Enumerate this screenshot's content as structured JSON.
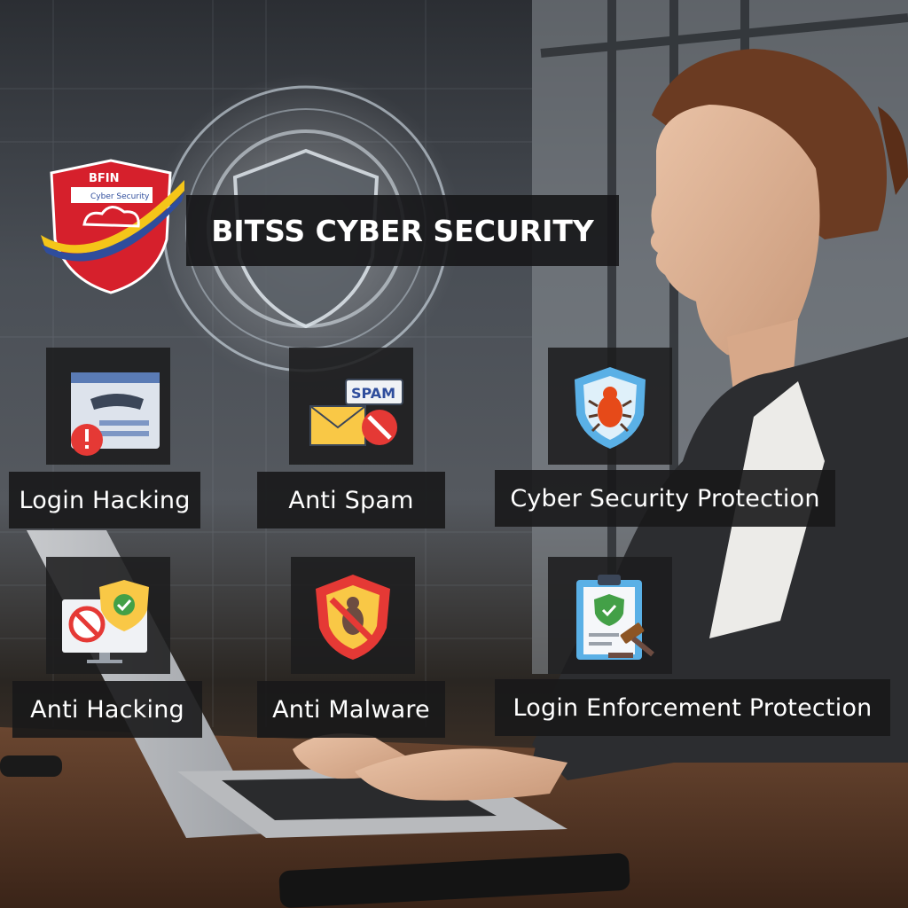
{
  "title": "BITSS CYBER SECURITY",
  "logo": {
    "brand": "BFIN",
    "subtitle": "Cyber Security",
    "colors": {
      "red": "#d6202c",
      "yellow": "#f4c519",
      "blue": "#2f4d9c",
      "white": "#ffffff"
    }
  },
  "features": [
    {
      "label": "Login Hacking",
      "icon": "login-hacking-icon"
    },
    {
      "label": "Anti Spam",
      "icon": "spam-mail-icon"
    },
    {
      "label": "Cyber Security Protection",
      "icon": "bug-shield-icon"
    },
    {
      "label": "Anti Hacking",
      "icon": "anti-hacking-monitor-icon"
    },
    {
      "label": "Anti Malware",
      "icon": "malware-shield-icon"
    },
    {
      "label": "Login Enforcement Protection",
      "icon": "clipboard-gavel-icon"
    }
  ],
  "colors": {
    "panel": "#1c1c1e",
    "text": "#ffffff",
    "accent_red": "#e53935",
    "accent_yellow": "#f9c846",
    "accent_blue": "#5ab0e6"
  }
}
